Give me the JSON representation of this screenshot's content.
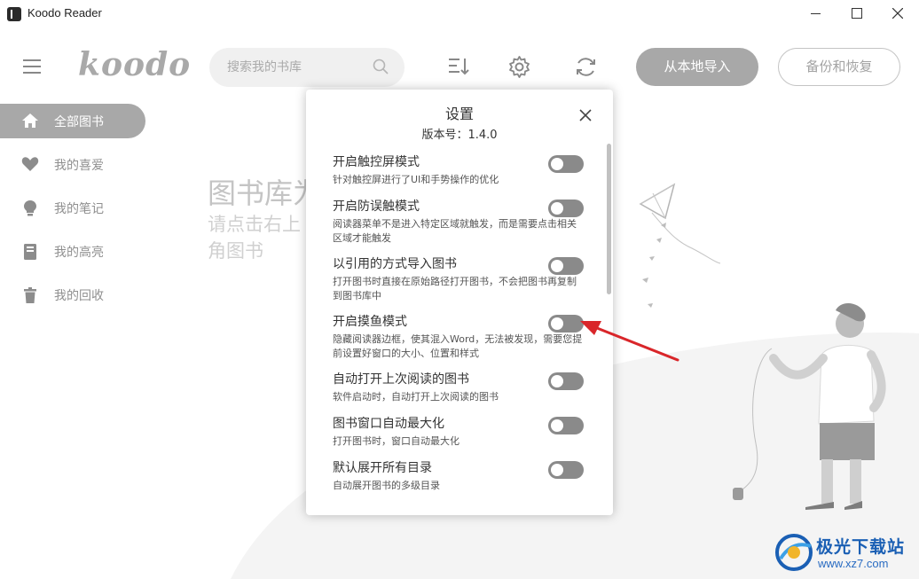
{
  "window": {
    "title": "Koodo Reader"
  },
  "header": {
    "logo_text": "koodo",
    "search_placeholder": "搜索我的书库",
    "import_button": "从本地导入",
    "backup_button": "备份和恢复"
  },
  "sidebar": {
    "items": [
      {
        "label": "全部图书",
        "icon": "home-icon",
        "active": true
      },
      {
        "label": "我的喜爱",
        "icon": "heart-icon",
        "active": false
      },
      {
        "label": "我的笔记",
        "icon": "lightbulb-icon",
        "active": false
      },
      {
        "label": "我的高亮",
        "icon": "highlight-book-icon",
        "active": false
      },
      {
        "label": "我的回收",
        "icon": "trash-icon",
        "active": false
      }
    ]
  },
  "empty_state": {
    "title": "图书库为",
    "subtitle": "请点击右上角图书"
  },
  "settings_dialog": {
    "title": "设置",
    "version": "版本号：1.4.0",
    "items": [
      {
        "title": "开启触控屏模式",
        "desc": "针对触控屏进行了UI和手势操作的优化",
        "enabled": false
      },
      {
        "title": "开启防误触模式",
        "desc": "阅读器菜单不是进入特定区域就触发，而是需要点击相关区域才能触发",
        "enabled": false
      },
      {
        "title": "以引用的方式导入图书",
        "desc": "打开图书时直接在原始路径打开图书，不会把图书再复制到图书库中",
        "enabled": false
      },
      {
        "title": "开启摸鱼模式",
        "desc": "隐藏阅读器边框，使其混入Word，无法被发现，需要您提前设置好窗口的大小、位置和样式",
        "enabled": false
      },
      {
        "title": "自动打开上次阅读的图书",
        "desc": "软件启动时，自动打开上次阅读的图书",
        "enabled": false
      },
      {
        "title": "图书窗口自动最大化",
        "desc": "打开图书时，窗口自动最大化",
        "enabled": false
      },
      {
        "title": "默认展开所有目录",
        "desc": "自动展开图书的多级目录",
        "enabled": false
      }
    ]
  },
  "watermark": {
    "name": "极光下载站",
    "url": "www.xz7.com"
  },
  "colors": {
    "accent_gray": "#a8a8a8",
    "toggle_off": "#8a8a8a",
    "annotation_arrow": "#d9262a",
    "watermark_blue": "#1a5fb4"
  }
}
